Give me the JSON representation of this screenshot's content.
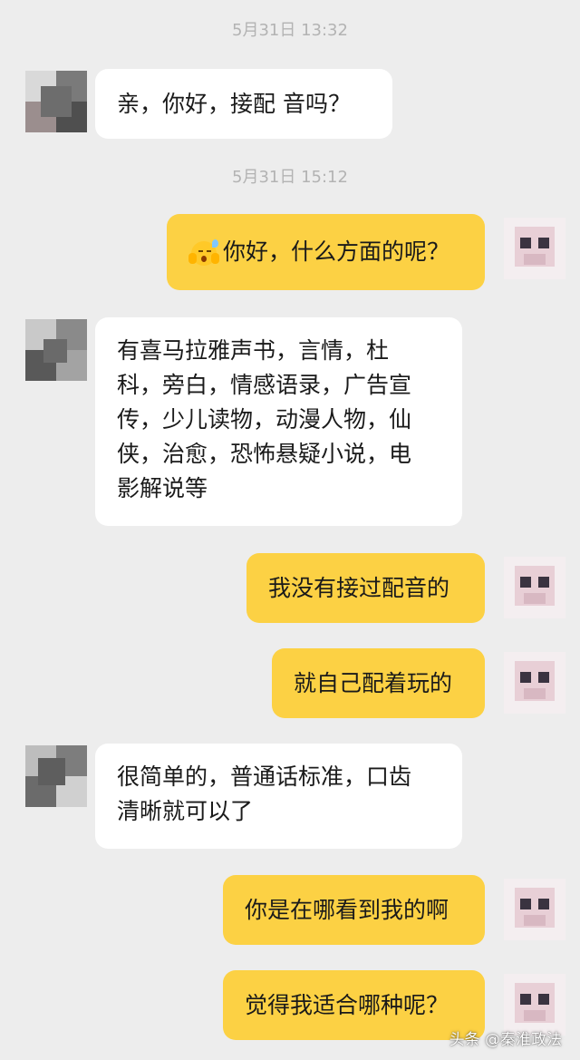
{
  "timestamps": [
    "5月31日 13:32",
    "5月31日 15:12"
  ],
  "messages": [
    {
      "from": "contact",
      "text": "亲，你好，接配 音吗？"
    },
    {
      "from": "me",
      "emoji": "embarrassed-face-emoji",
      "text": "你好，什么方面的呢？"
    },
    {
      "from": "contact",
      "lines": [
        "有喜马拉雅声书，言情，杜",
        "科，旁白，情感语录，广告宣",
        "传，少儿读物，动漫人物，仙",
        "侠，治愈，恐怖悬疑小说，电",
        "影解说等"
      ]
    },
    {
      "from": "me",
      "text": "我没有接过配音的"
    },
    {
      "from": "me",
      "text": "就自己配着玩的"
    },
    {
      "from": "contact",
      "lines": [
        "很简单的，普通话标准，口齿",
        "清晰就可以了"
      ]
    },
    {
      "from": "me",
      "text": "你是在哪看到我的啊"
    },
    {
      "from": "me",
      "text": "觉得我适合哪种呢？"
    }
  ],
  "watermark": "头条 @秦淮政法",
  "colors": {
    "background": "#ededed",
    "incoming_bubble": "#ffffff",
    "outgoing_bubble": "#fcd144",
    "timestamp": "#b3b3b3"
  }
}
